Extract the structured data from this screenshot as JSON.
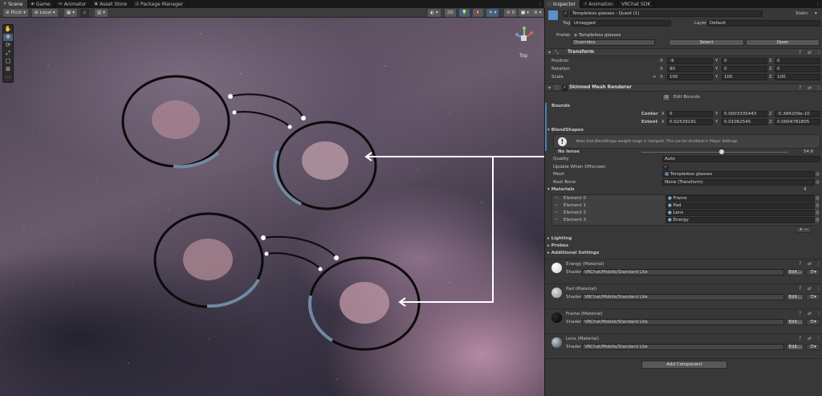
{
  "tabs_left": [
    {
      "label": "Scene",
      "icon": "hash-icon",
      "active": true
    },
    {
      "label": "Game",
      "icon": "gamepad-icon",
      "active": false
    },
    {
      "label": "Animator",
      "icon": "animator-icon",
      "active": false
    },
    {
      "label": "Asset Store",
      "icon": "store-icon",
      "active": false
    },
    {
      "label": "Package Manager",
      "icon": "package-icon",
      "active": false
    }
  ],
  "tabs_right": [
    {
      "label": "Inspector",
      "icon": "info-icon",
      "active": true
    },
    {
      "label": "Animation",
      "icon": "animation-icon",
      "active": false
    },
    {
      "label": "VRChat SDK",
      "icon": "",
      "active": false
    }
  ],
  "scene_toolbar": {
    "pivot_label": "Pivot",
    "local_label": "Local",
    "two_d_label": "2D",
    "gizmo_label": "Top"
  },
  "inspector": {
    "object_name": "Templeless glasses - Quest (1)",
    "static_label": "Static",
    "tag_label": "Tag",
    "tag_value": "Untagged",
    "layer_label": "Layer",
    "layer_value": "Default",
    "prefab_label": "Prefab",
    "prefab_value": "Templeless glasses",
    "overrides_label": "Overrides",
    "select_label": "Select",
    "open_label": "Open",
    "transform": {
      "title": "Transform",
      "position_label": "Position",
      "rotation_label": "Rotation",
      "scale_label": "Scale",
      "position": [
        "-9",
        "0",
        "0"
      ],
      "rotation": [
        "90",
        "0",
        "0"
      ],
      "scale": [
        "100",
        "100",
        "100"
      ],
      "axes": [
        "X",
        "Y",
        "Z"
      ]
    },
    "smr": {
      "title": "Skinned Mesh Renderer",
      "edit_bounds_label": "Edit Bounds",
      "bounds_label": "Bounds",
      "center_label": "Center",
      "extent_label": "Extent",
      "center": [
        "0",
        "0.0003335443",
        "-5.384209e-10"
      ],
      "extent": [
        "0.02529191",
        "0.01062545",
        "0.0004781805"
      ],
      "blendshapes_label": "BlendShapes",
      "blendshape_note": "Note that BlendShape weight range is clamped. This can be disabled in Player Settings.",
      "no_lense_label": "No lense",
      "no_lense_value": "54.6",
      "no_lense_fraction": 0.546,
      "quality_label": "Quality",
      "quality_value": "Auto",
      "update_offscreen_label": "Update When Offscreen",
      "mesh_label": "Mesh",
      "mesh_value": "Templeless glasses",
      "root_bone_label": "Root Bone",
      "root_bone_value": "None (Transform)",
      "materials_label": "Materials",
      "materials_count": "4",
      "elements": [
        {
          "label": "Element 0",
          "value": "Frame"
        },
        {
          "label": "Element 1",
          "value": "Pad"
        },
        {
          "label": "Element 2",
          "value": "Lens"
        },
        {
          "label": "Element 3",
          "value": "Energy"
        }
      ],
      "lighting_label": "Lighting",
      "probes_label": "Probes",
      "additional_label": "Additional Settings"
    },
    "materials": [
      {
        "name": "Energy",
        "suffix": "(Material)",
        "shader_label": "Shader",
        "shader": "VRChat/Mobile/Standard Lite",
        "edit_label": "Edit...",
        "ball_color": "#f2f2f2"
      },
      {
        "name": "Pad",
        "suffix": "(Material)",
        "shader_label": "Shader",
        "shader": "VRChat/Mobile/Standard Lite",
        "edit_label": "Edit...",
        "ball_color": "#b0b0b0"
      },
      {
        "name": "Frame",
        "suffix": "(Material)",
        "shader_label": "Shader",
        "shader": "VRChat/Mobile/Standard Lite",
        "edit_label": "Edit...",
        "ball_color": "#050505"
      },
      {
        "name": "Lens",
        "suffix": "(Material)",
        "shader_label": "Shader",
        "shader": "VRChat/Mobile/Standard Lite",
        "edit_label": "Edit...",
        "ball_color": "#6f7d8c"
      }
    ],
    "add_component_label": "Add Component"
  },
  "colors": {
    "panel": "#383838",
    "field": "#2a2a2a",
    "accent_blue": "#4f7fb7",
    "frame_blue": "#6f8aa3"
  }
}
